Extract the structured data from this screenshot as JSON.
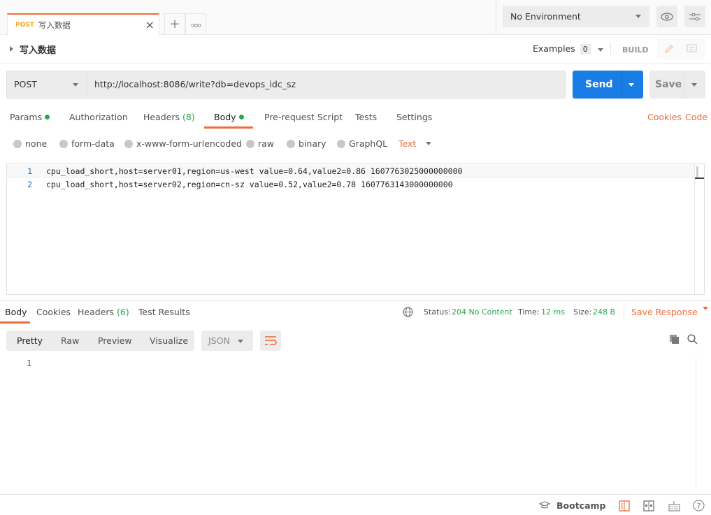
{
  "tabs": [
    {
      "method": "POST",
      "title": "写入数据"
    }
  ],
  "environment": {
    "selected": "No Environment"
  },
  "request": {
    "name": "写入数据",
    "examples_label": "Examples",
    "examples_count": "0",
    "build_label": "BUILD",
    "method": "POST",
    "url": "http://localhost:8086/write?db=devops_idc_sz",
    "send_label": "Send",
    "save_label": "Save"
  },
  "request_tabs": {
    "params": "Params",
    "authorization": "Authorization",
    "headers": "Headers",
    "headers_count": "(8)",
    "body": "Body",
    "prerequest": "Pre-request Script",
    "tests": "Tests",
    "settings": "Settings",
    "cookies": "Cookies",
    "code": "Code"
  },
  "body_types": {
    "none": "none",
    "form_data": "form-data",
    "urlencoded": "x-www-form-urlencoded",
    "raw": "raw",
    "binary": "binary",
    "graphql": "GraphQL",
    "format": "Text",
    "selected": "raw"
  },
  "body_lines": [
    {
      "n": "1",
      "text": "cpu_load_short,host=server01,region=us-west value=0.64,value2=0.86 1607763025000000000"
    },
    {
      "n": "2",
      "text": "cpu_load_short,host=server02,region=cn-sz value=0.52,value2=0.78 1607763143000000000"
    }
  ],
  "response": {
    "tabs": {
      "body": "Body",
      "cookies": "Cookies",
      "headers": "Headers",
      "headers_count": "(6)",
      "test_results": "Test Results"
    },
    "status_label": "Status:",
    "status": "204 No Content",
    "time_label": "Time:",
    "time": "12 ms",
    "size_label": "Size:",
    "size": "248 B",
    "save_response": "Save Response",
    "views": {
      "pretty": "Pretty",
      "raw": "Raw",
      "preview": "Preview",
      "visualize": "Visualize"
    },
    "format": "JSON",
    "lines": [
      "1"
    ]
  },
  "footer": {
    "bootcamp": "Bootcamp"
  },
  "colors": {
    "accent": "#f26b3a",
    "send": "#1a7de6",
    "success": "#26a74a"
  }
}
